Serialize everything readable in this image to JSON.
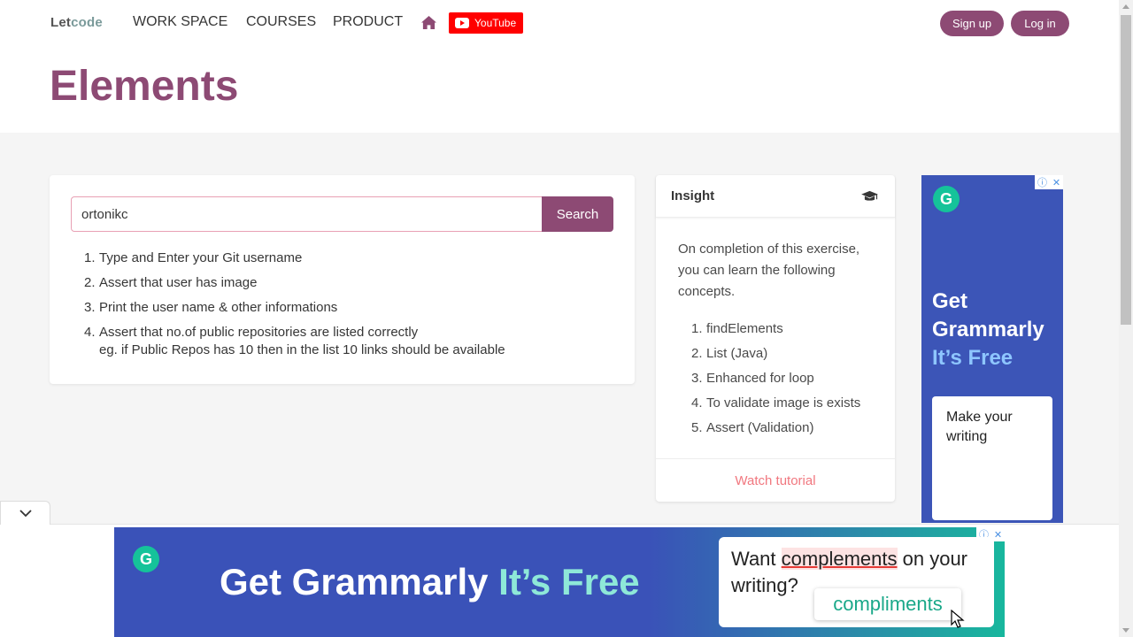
{
  "nav": {
    "logo_prefix": "Let",
    "logo_suffix": "code",
    "items": [
      "WORK SPACE",
      "COURSES",
      "PRODUCT"
    ],
    "youtube_label": "YouTube",
    "signup_label": "Sign up",
    "login_label": "Log in"
  },
  "page": {
    "title": "Elements"
  },
  "search": {
    "value": "ortonikc",
    "button_label": "Search"
  },
  "steps": [
    {
      "num": "1.",
      "text": "Type and Enter your Git username"
    },
    {
      "num": "2.",
      "text": "Assert that user has image"
    },
    {
      "num": "3.",
      "text": "Print the user name & other informations"
    },
    {
      "num": "4.",
      "text": "Assert that no.of public repositories are listed correctly",
      "sub": "eg. if Public Repos has 10 then in the list 10 links should be available"
    }
  ],
  "insight": {
    "title": "Insight",
    "description": "On completion of this exercise, you can learn the following concepts.",
    "items": [
      {
        "num": "1.",
        "text": "findElements"
      },
      {
        "num": "2.",
        "text": "List (Java)"
      },
      {
        "num": "3.",
        "text": "Enhanced for loop"
      },
      {
        "num": "4.",
        "text": "To validate image is exists"
      },
      {
        "num": "5.",
        "text": "Assert (Validation)"
      }
    ],
    "footer_link": "Watch tutorial"
  },
  "side_ad": {
    "line1": "Get",
    "line2": "Grammarly",
    "line3": "It’s Free",
    "box_line1": "Make your",
    "box_line2": "writing"
  },
  "bottom_ad": {
    "headline_main": "Get Grammarly",
    "headline_free": "It’s Free",
    "box_prefix": "Want",
    "box_highlight": "complements",
    "box_suffix": "on your",
    "box_line2": "writing?",
    "suggestion": "compliments"
  },
  "colors": {
    "brand": "#8d4a74",
    "link": "#f1777f",
    "youtube": "#ff0000",
    "grammarly_blue": "#3c55b7",
    "grammarly_green": "#15c39a"
  }
}
